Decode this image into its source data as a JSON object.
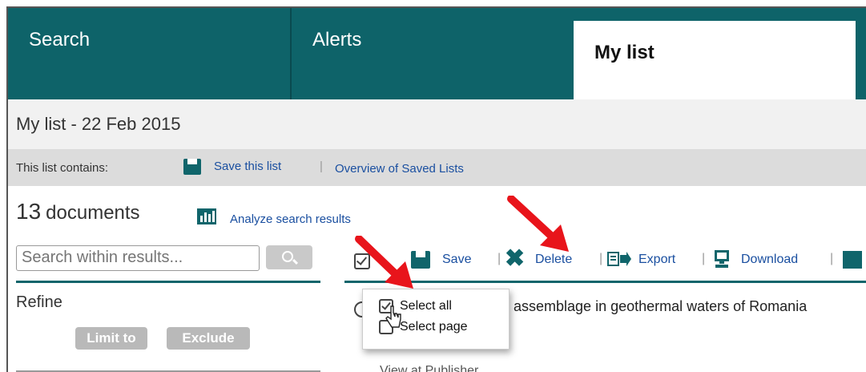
{
  "tabs": {
    "search": "Search",
    "alerts": "Alerts",
    "mylist": "My list"
  },
  "page_title": "My list - 22 Feb 2015",
  "contains": {
    "label": "This list contains:",
    "save_link": "Save this list",
    "separator": "|",
    "overview_link": "Overview of Saved Lists"
  },
  "results": {
    "count": "13",
    "count_word": "documents",
    "analyze_link": "Analyze search results"
  },
  "search": {
    "placeholder": "Search within results..."
  },
  "refine": {
    "title": "Refine",
    "limit_label": "Limit to",
    "exclude_label": "Exclude"
  },
  "toolbar": {
    "save": "Save",
    "delete": "Delete",
    "export": "Export",
    "download": "Download",
    "separator": "|"
  },
  "select_menu": {
    "select_all": "Select all",
    "select_page": "Select page"
  },
  "result_item": {
    "title_visible": "h assemblage in geothermal waters of Romania",
    "meta_visible": "View at Publisher"
  },
  "colors": {
    "teal": "#0e6369",
    "link": "#1a4fa0",
    "arrow": "#e8141b"
  },
  "icons": [
    "save-icon",
    "analyze-icon",
    "search-icon",
    "delete-icon",
    "export-icon",
    "download-icon",
    "checkbox-icon",
    "pointer-cursor-icon"
  ]
}
